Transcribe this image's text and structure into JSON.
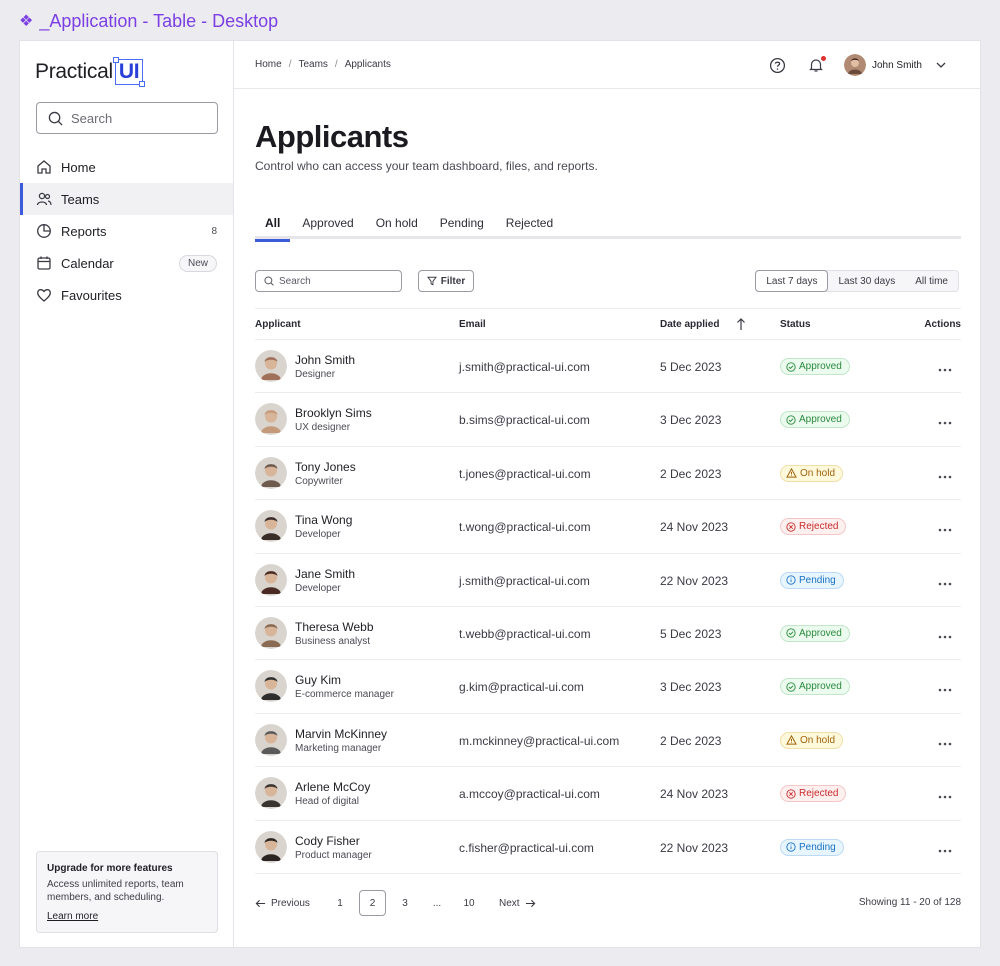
{
  "frame": {
    "title": "_Application - Table - Desktop"
  },
  "logo": {
    "text": "Practical",
    "box": "UI"
  },
  "sidebar": {
    "search_placeholder": "Search",
    "items": [
      {
        "label": "Home",
        "icon": "home-icon",
        "badge": ""
      },
      {
        "label": "Teams",
        "icon": "users-icon",
        "badge": ""
      },
      {
        "label": "Reports",
        "icon": "pie-chart-icon",
        "badge": "8"
      },
      {
        "label": "Calendar",
        "icon": "calendar-icon",
        "badge": "New"
      },
      {
        "label": "Favourites",
        "icon": "heart-icon",
        "badge": ""
      }
    ],
    "active_index": 1,
    "upgrade": {
      "title": "Upgrade for more features",
      "desc": "Access unlimited reports, team members, and scheduling.",
      "link": "Learn more"
    }
  },
  "header": {
    "breadcrumbs": [
      "Home",
      "Teams",
      "Applicants"
    ],
    "user_name": "John Smith"
  },
  "page": {
    "title": "Applicants",
    "subtitle": "Control who can access your team dashboard, files, and reports."
  },
  "tabs": [
    "All",
    "Approved",
    "On hold",
    "Pending",
    "Rejected"
  ],
  "toolbar": {
    "search_placeholder": "Search",
    "filter_label": "Filter",
    "ranges": [
      "Last 7 days",
      "Last 30 days",
      "All time"
    ]
  },
  "table": {
    "headers": {
      "applicant": "Applicant",
      "email": "Email",
      "date": "Date applied",
      "status": "Status",
      "actions": "Actions"
    },
    "rows": [
      {
        "name": "John Smith",
        "role": "Designer",
        "email": "j.smith@practical-ui.com",
        "date": "5 Dec 2023",
        "status": "Approved",
        "status_key": "approved",
        "avatar_color": "#a0705a"
      },
      {
        "name": "Brooklyn Sims",
        "role": "UX designer",
        "email": "b.sims@practical-ui.com",
        "date": "3 Dec 2023",
        "status": "Approved",
        "status_key": "approved",
        "avatar_color": "#c49a7a"
      },
      {
        "name": "Tony Jones",
        "role": "Copywriter",
        "email": "t.jones@practical-ui.com",
        "date": "2 Dec 2023",
        "status": "On hold",
        "status_key": "onhold",
        "avatar_color": "#6f5a4e"
      },
      {
        "name": "Tina Wong",
        "role": "Developer",
        "email": "t.wong@practical-ui.com",
        "date": "24 Nov 2023",
        "status": "Rejected",
        "status_key": "rejected",
        "avatar_color": "#3a2d28"
      },
      {
        "name": "Jane Smith",
        "role": "Developer",
        "email": "j.smith@practical-ui.com",
        "date": "22 Nov 2023",
        "status": "Pending",
        "status_key": "pending",
        "avatar_color": "#4a2a22"
      },
      {
        "name": "Theresa Webb",
        "role": "Business analyst",
        "email": "t.webb@practical-ui.com",
        "date": "5 Dec 2023",
        "status": "Approved",
        "status_key": "approved",
        "avatar_color": "#8a6a52"
      },
      {
        "name": "Guy Kim",
        "role": "E-commerce manager",
        "email": "g.kim@practical-ui.com",
        "date": "3 Dec 2023",
        "status": "Approved",
        "status_key": "approved",
        "avatar_color": "#2e2e2e"
      },
      {
        "name": "Marvin McKinney",
        "role": "Marketing manager",
        "email": "m.mckinney@practical-ui.com",
        "date": "2 Dec 2023",
        "status": "On hold",
        "status_key": "onhold",
        "avatar_color": "#5a5a5a"
      },
      {
        "name": "Arlene McCoy",
        "role": "Head of digital",
        "email": "a.mccoy@practical-ui.com",
        "date": "24 Nov 2023",
        "status": "Rejected",
        "status_key": "rejected",
        "avatar_color": "#3a3430"
      },
      {
        "name": "Cody Fisher",
        "role": "Product manager",
        "email": "c.fisher@practical-ui.com",
        "date": "22 Nov 2023",
        "status": "Pending",
        "status_key": "pending",
        "avatar_color": "#2a2422"
      }
    ]
  },
  "pagination": {
    "previous": "Previous",
    "pages": [
      "1",
      "2",
      "3",
      "...",
      "10"
    ],
    "current": "2",
    "next": "Next",
    "showing": "Showing 11 - 20 of 128"
  },
  "colors": {
    "accent": "#3b5bdb",
    "frame_title": "#7b3fe4"
  }
}
